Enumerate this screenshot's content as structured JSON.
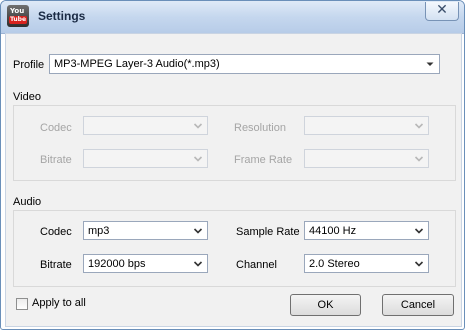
{
  "window": {
    "title": "Settings",
    "close_symbol": "✕"
  },
  "app_icon": {
    "top": "You",
    "bottom": "Tube"
  },
  "profile": {
    "label": "Profile",
    "value": "MP3-MPEG Layer-3 Audio(*.mp3)"
  },
  "video": {
    "section_label": "Video",
    "codec_label": "Codec",
    "codec_value": "",
    "bitrate_label": "Bitrate",
    "bitrate_value": "",
    "resolution_label": "Resolution",
    "resolution_value": "",
    "framerate_label": "Frame Rate",
    "framerate_value": ""
  },
  "audio": {
    "section_label": "Audio",
    "codec_label": "Codec",
    "codec_value": "mp3",
    "bitrate_label": "Bitrate",
    "bitrate_value": "192000 bps",
    "samplerate_label": "Sample Rate",
    "samplerate_value": "44100 Hz",
    "channel_label": "Channel",
    "channel_value": "2.0 Stereo"
  },
  "apply_all": {
    "label": "Apply to all",
    "checked": false
  },
  "buttons": {
    "ok": "OK",
    "cancel": "Cancel"
  }
}
